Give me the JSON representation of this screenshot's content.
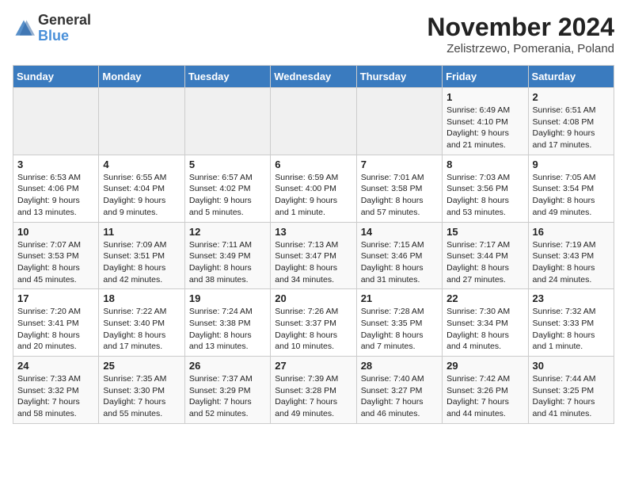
{
  "header": {
    "logo_general": "General",
    "logo_blue": "Blue",
    "month_title": "November 2024",
    "location": "Zelistrzewo, Pomerania, Poland"
  },
  "weekdays": [
    "Sunday",
    "Monday",
    "Tuesday",
    "Wednesday",
    "Thursday",
    "Friday",
    "Saturday"
  ],
  "weeks": [
    [
      {
        "day": "",
        "empty": true
      },
      {
        "day": "",
        "empty": true
      },
      {
        "day": "",
        "empty": true
      },
      {
        "day": "",
        "empty": true
      },
      {
        "day": "",
        "empty": true
      },
      {
        "day": "1",
        "sunrise": "Sunrise: 6:49 AM",
        "sunset": "Sunset: 4:10 PM",
        "daylight": "Daylight: 9 hours and 21 minutes."
      },
      {
        "day": "2",
        "sunrise": "Sunrise: 6:51 AM",
        "sunset": "Sunset: 4:08 PM",
        "daylight": "Daylight: 9 hours and 17 minutes."
      }
    ],
    [
      {
        "day": "3",
        "sunrise": "Sunrise: 6:53 AM",
        "sunset": "Sunset: 4:06 PM",
        "daylight": "Daylight: 9 hours and 13 minutes."
      },
      {
        "day": "4",
        "sunrise": "Sunrise: 6:55 AM",
        "sunset": "Sunset: 4:04 PM",
        "daylight": "Daylight: 9 hours and 9 minutes."
      },
      {
        "day": "5",
        "sunrise": "Sunrise: 6:57 AM",
        "sunset": "Sunset: 4:02 PM",
        "daylight": "Daylight: 9 hours and 5 minutes."
      },
      {
        "day": "6",
        "sunrise": "Sunrise: 6:59 AM",
        "sunset": "Sunset: 4:00 PM",
        "daylight": "Daylight: 9 hours and 1 minute."
      },
      {
        "day": "7",
        "sunrise": "Sunrise: 7:01 AM",
        "sunset": "Sunset: 3:58 PM",
        "daylight": "Daylight: 8 hours and 57 minutes."
      },
      {
        "day": "8",
        "sunrise": "Sunrise: 7:03 AM",
        "sunset": "Sunset: 3:56 PM",
        "daylight": "Daylight: 8 hours and 53 minutes."
      },
      {
        "day": "9",
        "sunrise": "Sunrise: 7:05 AM",
        "sunset": "Sunset: 3:54 PM",
        "daylight": "Daylight: 8 hours and 49 minutes."
      }
    ],
    [
      {
        "day": "10",
        "sunrise": "Sunrise: 7:07 AM",
        "sunset": "Sunset: 3:53 PM",
        "daylight": "Daylight: 8 hours and 45 minutes."
      },
      {
        "day": "11",
        "sunrise": "Sunrise: 7:09 AM",
        "sunset": "Sunset: 3:51 PM",
        "daylight": "Daylight: 8 hours and 42 minutes."
      },
      {
        "day": "12",
        "sunrise": "Sunrise: 7:11 AM",
        "sunset": "Sunset: 3:49 PM",
        "daylight": "Daylight: 8 hours and 38 minutes."
      },
      {
        "day": "13",
        "sunrise": "Sunrise: 7:13 AM",
        "sunset": "Sunset: 3:47 PM",
        "daylight": "Daylight: 8 hours and 34 minutes."
      },
      {
        "day": "14",
        "sunrise": "Sunrise: 7:15 AM",
        "sunset": "Sunset: 3:46 PM",
        "daylight": "Daylight: 8 hours and 31 minutes."
      },
      {
        "day": "15",
        "sunrise": "Sunrise: 7:17 AM",
        "sunset": "Sunset: 3:44 PM",
        "daylight": "Daylight: 8 hours and 27 minutes."
      },
      {
        "day": "16",
        "sunrise": "Sunrise: 7:19 AM",
        "sunset": "Sunset: 3:43 PM",
        "daylight": "Daylight: 8 hours and 24 minutes."
      }
    ],
    [
      {
        "day": "17",
        "sunrise": "Sunrise: 7:20 AM",
        "sunset": "Sunset: 3:41 PM",
        "daylight": "Daylight: 8 hours and 20 minutes."
      },
      {
        "day": "18",
        "sunrise": "Sunrise: 7:22 AM",
        "sunset": "Sunset: 3:40 PM",
        "daylight": "Daylight: 8 hours and 17 minutes."
      },
      {
        "day": "19",
        "sunrise": "Sunrise: 7:24 AM",
        "sunset": "Sunset: 3:38 PM",
        "daylight": "Daylight: 8 hours and 13 minutes."
      },
      {
        "day": "20",
        "sunrise": "Sunrise: 7:26 AM",
        "sunset": "Sunset: 3:37 PM",
        "daylight": "Daylight: 8 hours and 10 minutes."
      },
      {
        "day": "21",
        "sunrise": "Sunrise: 7:28 AM",
        "sunset": "Sunset: 3:35 PM",
        "daylight": "Daylight: 8 hours and 7 minutes."
      },
      {
        "day": "22",
        "sunrise": "Sunrise: 7:30 AM",
        "sunset": "Sunset: 3:34 PM",
        "daylight": "Daylight: 8 hours and 4 minutes."
      },
      {
        "day": "23",
        "sunrise": "Sunrise: 7:32 AM",
        "sunset": "Sunset: 3:33 PM",
        "daylight": "Daylight: 8 hours and 1 minute."
      }
    ],
    [
      {
        "day": "24",
        "sunrise": "Sunrise: 7:33 AM",
        "sunset": "Sunset: 3:32 PM",
        "daylight": "Daylight: 7 hours and 58 minutes."
      },
      {
        "day": "25",
        "sunrise": "Sunrise: 7:35 AM",
        "sunset": "Sunset: 3:30 PM",
        "daylight": "Daylight: 7 hours and 55 minutes."
      },
      {
        "day": "26",
        "sunrise": "Sunrise: 7:37 AM",
        "sunset": "Sunset: 3:29 PM",
        "daylight": "Daylight: 7 hours and 52 minutes."
      },
      {
        "day": "27",
        "sunrise": "Sunrise: 7:39 AM",
        "sunset": "Sunset: 3:28 PM",
        "daylight": "Daylight: 7 hours and 49 minutes."
      },
      {
        "day": "28",
        "sunrise": "Sunrise: 7:40 AM",
        "sunset": "Sunset: 3:27 PM",
        "daylight": "Daylight: 7 hours and 46 minutes."
      },
      {
        "day": "29",
        "sunrise": "Sunrise: 7:42 AM",
        "sunset": "Sunset: 3:26 PM",
        "daylight": "Daylight: 7 hours and 44 minutes."
      },
      {
        "day": "30",
        "sunrise": "Sunrise: 7:44 AM",
        "sunset": "Sunset: 3:25 PM",
        "daylight": "Daylight: 7 hours and 41 minutes."
      }
    ]
  ]
}
